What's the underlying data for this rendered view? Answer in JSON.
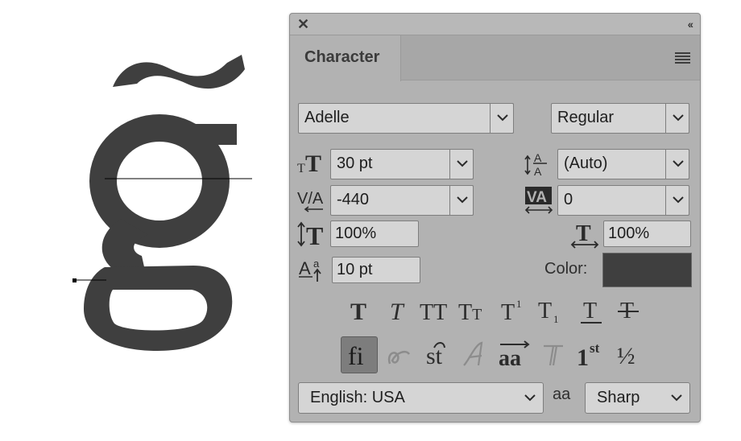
{
  "panel": {
    "tab_label": "Character",
    "font_family": "Adelle",
    "font_style": "Regular",
    "font_size": "30 pt",
    "leading": "(Auto)",
    "kerning": "-440",
    "tracking": "0",
    "vertical_scale": "100%",
    "horizontal_scale": "100%",
    "baseline_shift": "10 pt",
    "color_label": "Color:",
    "color_value": "#3f3f3f",
    "language": "English: USA",
    "antialias_label": "aa",
    "antialias": "Sharp",
    "style_buttons": [
      "T",
      "T",
      "TT",
      "Tt",
      "T",
      "T",
      "T",
      "T"
    ],
    "opentype_buttons": {
      "ligatures": "fi",
      "discretionary": "st",
      "fractions": "½",
      "ordinal_base": "1",
      "ordinal_sup": "st",
      "titling": "aa"
    }
  },
  "canvas": {
    "glyph_color": "#3f3f3f"
  }
}
